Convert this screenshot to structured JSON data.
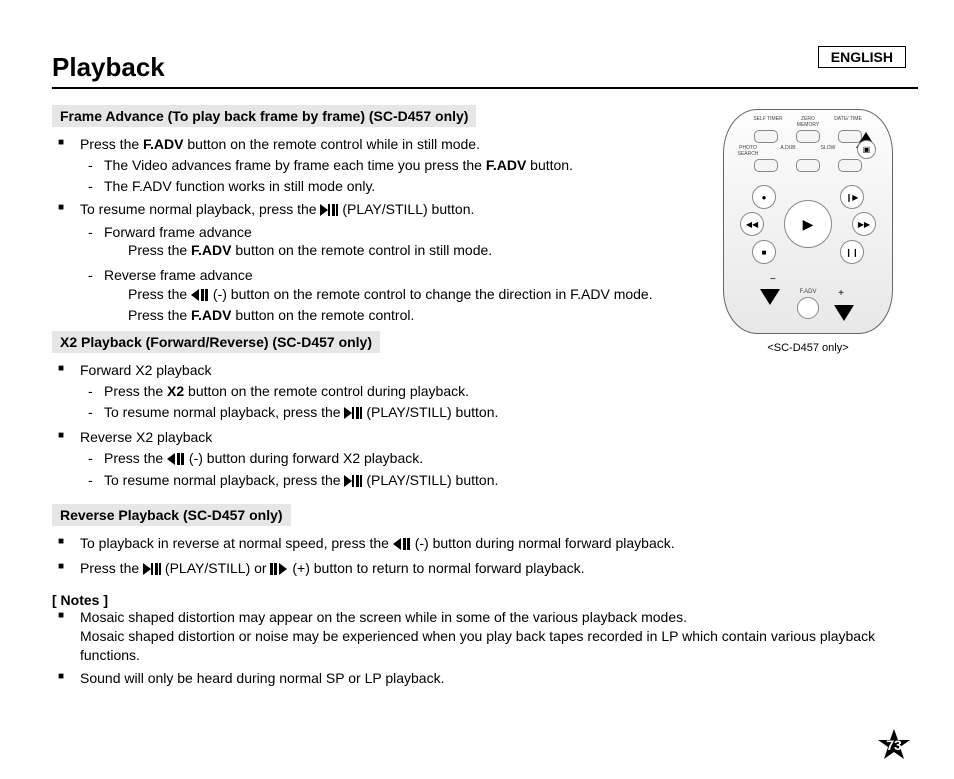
{
  "language_label": "ENGLISH",
  "page_title": "Playback",
  "figure_caption": "<SC-D457 only>",
  "remote_labels": {
    "self_timer": "SELF TIMER",
    "zero_memory": "ZERO MEMORY",
    "date_time": "DATE/ TIME",
    "photo_search": "PHOTO SEARCH",
    "adub": "A.DUB",
    "slow": "SLOW",
    "x2": "X2",
    "fadv": "F.ADV"
  },
  "sections": {
    "frame_advance": {
      "heading": "Frame Advance (To play back frame by frame) (SC-D457 only)",
      "b1_pre": "Press the ",
      "b1_bold": "F.ADV",
      "b1_post": " button on the remote control while in still mode.",
      "b1_d1_pre": "The Video advances frame by frame each time you press the ",
      "b1_d1_bold": "F.ADV",
      "b1_d1_post": " button.",
      "b1_d2": "The F.ADV function works in still mode only.",
      "b2_pre": "To resume normal playback, press the ",
      "b2_post": "(PLAY/STILL) button.",
      "b2_d1_title": "Forward frame advance",
      "b2_d1_line_pre": "Press the ",
      "b2_d1_line_bold": "F.ADV",
      "b2_d1_line_post": " button on the remote control in still mode.",
      "b2_d2_title": "Reverse frame advance",
      "b2_d2_l1_pre": "Press the ",
      "b2_d2_l1_post": "(-) button on the remote control to change the direction in F.ADV mode.",
      "b2_d2_l2_pre": "Press the ",
      "b2_d2_l2_bold": "F.ADV",
      "b2_d2_l2_post": " button on the remote control."
    },
    "x2": {
      "heading": "X2 Playback (Forward/Reverse) (SC-D457 only)",
      "b1_title": "Forward X2 playback",
      "b1_d1_pre": "Press the ",
      "b1_d1_bold": "X2",
      "b1_d1_post": " button on the remote control during playback.",
      "b1_d2_pre": "To resume normal playback, press the ",
      "b1_d2_post": "(PLAY/STILL) button.",
      "b2_title": "Reverse X2 playback",
      "b2_d1_pre": "Press the ",
      "b2_d1_post": "(-) button during forward X2 playback.",
      "b2_d2_pre": "To resume normal playback, press the ",
      "b2_d2_post": "(PLAY/STILL) button."
    },
    "reverse": {
      "heading": "Reverse Playback (SC-D457 only)",
      "b1_pre": "To playback in reverse at normal speed, press the ",
      "b1_post": "(-) button during normal forward playback.",
      "b2_pre": "Press the ",
      "b2_mid": "(PLAY/STILL) or ",
      "b2_post": "(+) button to return to normal forward playback."
    },
    "notes": {
      "title": "[ Notes ]",
      "b1_l1": "Mosaic shaped distortion may appear on the screen while in some of the various playback modes.",
      "b1_l2": "Mosaic shaped distortion or noise may be experienced when you play back tapes recorded in LP which contain various playback functions.",
      "b2": "Sound will only be heard during normal SP or LP playback."
    }
  },
  "page_number": "73"
}
